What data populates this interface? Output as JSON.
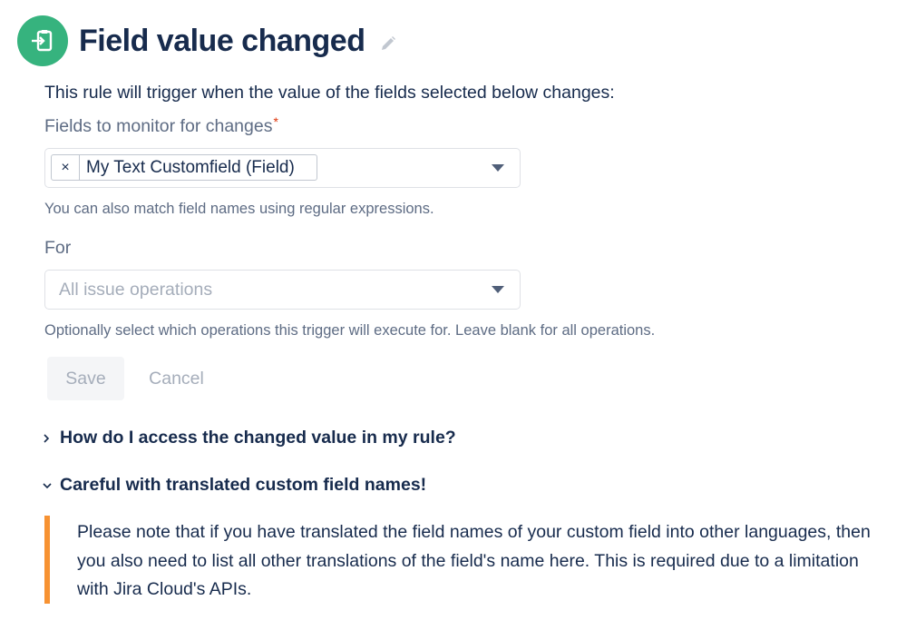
{
  "header": {
    "title": "Field value changed",
    "icon": "field-change-trigger-icon",
    "edit_icon": "pencil-icon",
    "accent_color": "#36b37e"
  },
  "form": {
    "intro": "This rule will trigger when the value of the fields selected below changes:",
    "fields": {
      "label": "Fields to monitor for changes",
      "required_marker": "*",
      "selected_tag": "My Text Customfield (Field)",
      "tag_remove": "×",
      "help": "You can also match field names using regular expressions."
    },
    "operations": {
      "label": "For",
      "placeholder": "All issue operations",
      "help": "Optionally select which operations this trigger will execute for. Leave blank for all operations."
    },
    "buttons": {
      "save": "Save",
      "cancel": "Cancel"
    }
  },
  "faq": [
    {
      "title": "How do I access the changed value in my rule?",
      "expanded": false
    },
    {
      "title": "Careful with translated custom field names!",
      "expanded": true
    }
  ],
  "note": {
    "text": "Please note that if you have translated the field names of your custom field into other languages, then you also need to list all other translations of the field's name here. This is required due to a limitation with Jira Cloud's APIs.",
    "border_color": "#f79232"
  }
}
